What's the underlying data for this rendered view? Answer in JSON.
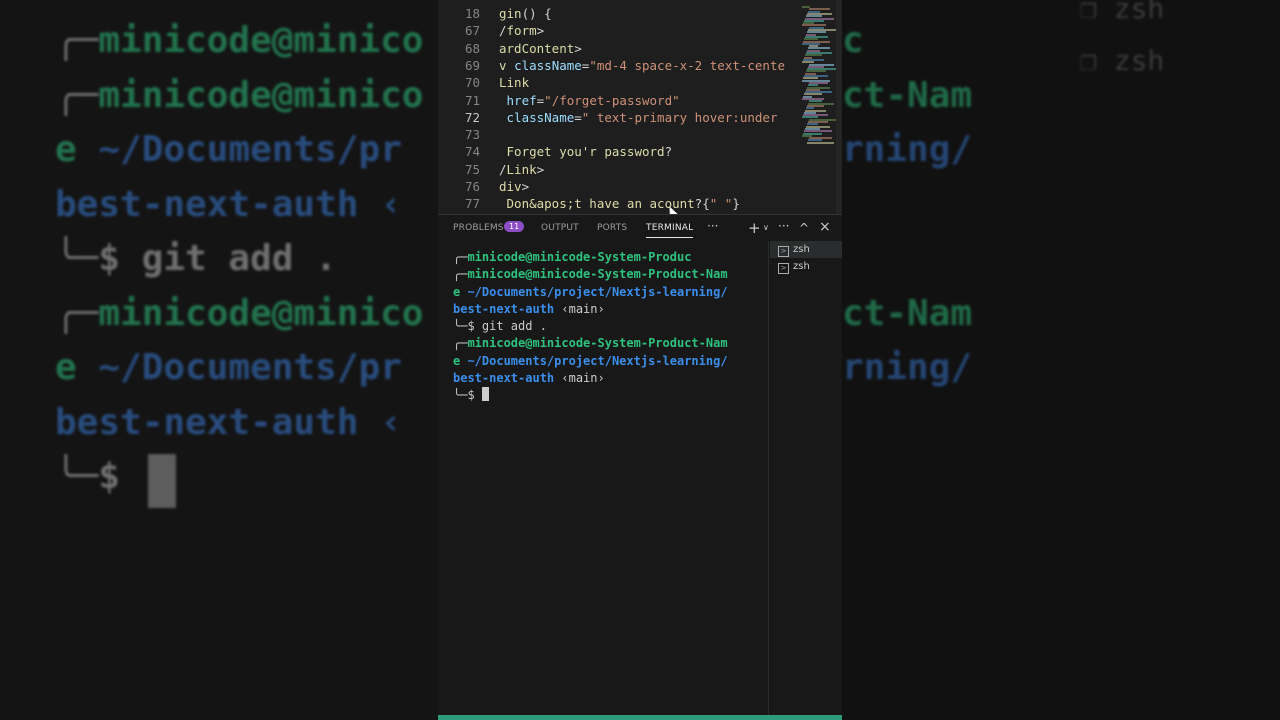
{
  "editor": {
    "lines": [
      {
        "num": "18",
        "code": "gin() {"
      },
      {
        "num": "67",
        "code": "/form>"
      },
      {
        "num": "68",
        "code": "ardContent>"
      },
      {
        "num": "69",
        "code": "v className=\"md-4 space-x-2 text-cente"
      },
      {
        "num": "70",
        "code": "Link"
      },
      {
        "num": "71",
        "code": " href=\"/forget-password\""
      },
      {
        "num": "72",
        "code": " className=\" text-primary hover:under"
      },
      {
        "num": "73",
        "code": ""
      },
      {
        "num": "74",
        "code": " Forget you'r password?"
      },
      {
        "num": "75",
        "code": "/Link>"
      },
      {
        "num": "76",
        "code": "div>"
      },
      {
        "num": "77",
        "code": " Don&apos;t have an acount?{\" \"}"
      }
    ]
  },
  "panel": {
    "tabs": {
      "problems": "PROBLEMS",
      "problems_count": "11",
      "output": "OUTPUT",
      "ports": "PORTS",
      "terminal": "TERMINAL",
      "more": "···"
    },
    "actions": {
      "add": "+",
      "split": "∨",
      "more": "···",
      "maximize": "^",
      "close": "×"
    }
  },
  "terminal": {
    "lines": [
      {
        "prefix": "╭─",
        "user": "minicode@minicode-System-Produc",
        "path": "",
        "branch": "",
        "cmd": ""
      },
      {
        "prefix": "╭─",
        "user": "minicode@minicode-System-Product-Nam",
        "path": "",
        "branch": "",
        "cmd": ""
      },
      {
        "prefix": "",
        "user": "e",
        "path": " ~/Documents/project/Nextjs-learning/",
        "branch": "",
        "cmd": ""
      },
      {
        "prefix": "",
        "user": "",
        "path": "best-next-auth",
        "branch": " ‹main›",
        "cmd": ""
      },
      {
        "prefix": "╰─$ ",
        "user": "",
        "path": "",
        "branch": "",
        "cmd": "git add ."
      },
      {
        "prefix": "╭─",
        "user": "minicode@minicode-System-Product-Nam",
        "path": "",
        "branch": "",
        "cmd": ""
      },
      {
        "prefix": "",
        "user": "e",
        "path": " ~/Documents/project/Nextjs-learning/",
        "branch": "",
        "cmd": ""
      },
      {
        "prefix": "",
        "user": "",
        "path": "best-next-auth",
        "branch": " ‹main›",
        "cmd": ""
      },
      {
        "prefix": "╰─$ ",
        "user": "",
        "path": "",
        "branch": "",
        "cmd": ""
      }
    ],
    "sessions": [
      "zsh",
      "zsh"
    ]
  },
  "background": {
    "left_lines": [
      {
        "prefix": "╭─",
        "user": "minicode@minico",
        "path": ""
      },
      {
        "prefix": "╭─",
        "user": "minicode@minico",
        "path": ""
      },
      {
        "prefix": "",
        "user": "e",
        "path": " ~/Documents/pr"
      },
      {
        "prefix": "",
        "user": "",
        "path": "best-next-auth ‹"
      },
      {
        "prefix": "╰─$ ",
        "user": "",
        "path": "",
        "cmd": "git add ."
      },
      {
        "prefix": "╭─",
        "user": "minicode@minico",
        "path": ""
      },
      {
        "prefix": "",
        "user": "e",
        "path": " ~/Documents/pr"
      },
      {
        "prefix": "",
        "user": "",
        "path": "best-next-auth ‹"
      },
      {
        "prefix": "╰─$ ",
        "user": "",
        "path": ""
      }
    ],
    "right_lines": [
      {
        "user": "c",
        "path": ""
      },
      {
        "user": "ct-Nam",
        "path": ""
      },
      {
        "user": "",
        "path": "rning/"
      },
      {
        "user": "",
        "path": ""
      },
      {
        "user": "",
        "path": ""
      },
      {
        "user": "ct-Nam",
        "path": ""
      },
      {
        "user": "",
        "path": "rning/"
      }
    ],
    "right_tabs": [
      "zsh",
      "zsh"
    ]
  },
  "colors": {
    "green": "#2ec27e",
    "blue": "#3b8eea",
    "badge": "#8c4ec4",
    "status": "#2c9c7c"
  }
}
